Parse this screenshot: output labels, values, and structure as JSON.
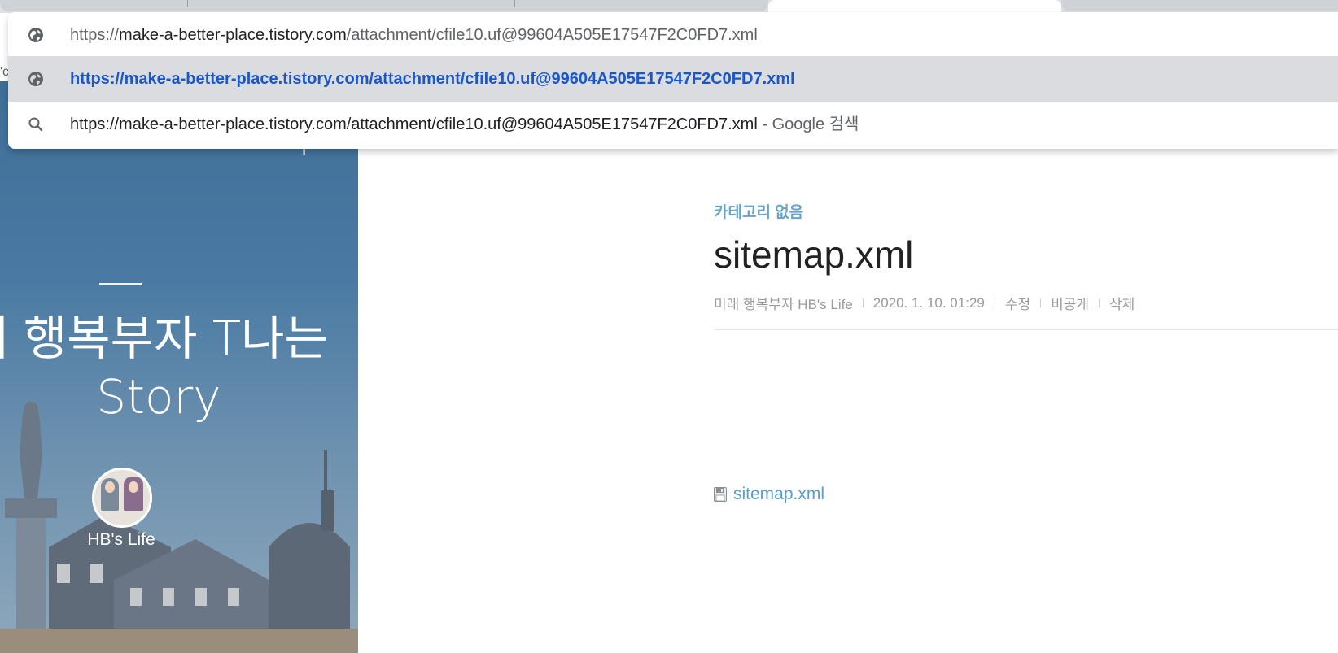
{
  "omnibox": {
    "input": {
      "host_prefix": "https://",
      "host": "make-a-better-place.tistory.com",
      "path": "/attachment/cfile10.uf@99604A505E17547F2C0FD7.xml"
    },
    "suggestion_url": "https://make-a-better-place.tistory.com/attachment/cfile10.uf@99604A505E17547F2C0FD7.xml",
    "search_query": "https://make-a-better-place.tistory.com/attachment/cfile10.uf@99604A505E17547F2C0FD7.xml",
    "search_suffix": " - Google 검색",
    "left_fragment": "'c"
  },
  "sidebar": {
    "title_line1": "래 행복부자 T나는",
    "title_line2": "Story",
    "blog_name": "HB's Life"
  },
  "post": {
    "category": "카테고리 없음",
    "title": "sitemap.xml",
    "author": "미래 행복부자 HB's Life",
    "date": "2020. 1. 10. 01:29",
    "edit_label": "수정",
    "private_label": "비공개",
    "delete_label": "삭제",
    "attachment_name": "sitemap.xml"
  },
  "colors": {
    "suggestion_link": "#1a57c9",
    "category": "#6aa3c8",
    "attachment_link": "#5a9ec8",
    "highlight_row": "#dadce0"
  },
  "icons": {
    "url_row": "globe-icon",
    "suggestion_row": "globe-icon",
    "search_row": "search-icon",
    "attachment": "floppy-disk-icon"
  }
}
